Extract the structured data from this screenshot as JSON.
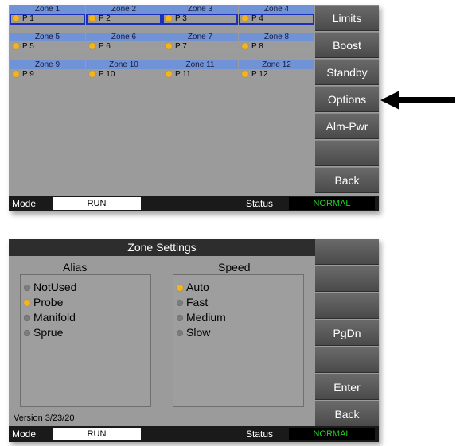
{
  "screen1": {
    "zones": [
      {
        "name": "Zone 1",
        "label": "P 1",
        "selected": true
      },
      {
        "name": "Zone 2",
        "label": "P 2",
        "selected": true
      },
      {
        "name": "Zone 3",
        "label": "P 3",
        "selected": true
      },
      {
        "name": "Zone 4",
        "label": "P 4",
        "selected": true
      },
      {
        "name": "Zone 5",
        "label": "P 5",
        "selected": false
      },
      {
        "name": "Zone 6",
        "label": "P 6",
        "selected": false
      },
      {
        "name": "Zone 7",
        "label": "P 7",
        "selected": false
      },
      {
        "name": "Zone 8",
        "label": "P 8",
        "selected": false
      },
      {
        "name": "Zone 9",
        "label": "P 9",
        "selected": false
      },
      {
        "name": "Zone 10",
        "label": "P 10",
        "selected": false
      },
      {
        "name": "Zone 11",
        "label": "P 11",
        "selected": false
      },
      {
        "name": "Zone 12",
        "label": "P 12",
        "selected": false
      }
    ],
    "buttons": [
      "Limits",
      "Boost",
      "Standby",
      "Options",
      "Alm-Pwr",
      "",
      "Back"
    ],
    "status": {
      "mode_label": "Mode",
      "mode_value": "RUN",
      "status_label": "Status",
      "status_value": "NORMAL"
    }
  },
  "screen2": {
    "title": "Zone Settings",
    "alias_header": "Alias",
    "speed_header": "Speed",
    "alias_options": [
      {
        "label": "NotUsed",
        "on": false
      },
      {
        "label": "Probe",
        "on": true
      },
      {
        "label": "Manifold",
        "on": false
      },
      {
        "label": "Sprue",
        "on": false
      }
    ],
    "speed_options": [
      {
        "label": "Auto",
        "on": true
      },
      {
        "label": "Fast",
        "on": false
      },
      {
        "label": "Medium",
        "on": false
      },
      {
        "label": "Slow",
        "on": false
      }
    ],
    "buttons": [
      "",
      "",
      "",
      "PgDn",
      "",
      "Enter",
      "Back"
    ],
    "version": "Version 3/23/20",
    "status": {
      "mode_label": "Mode",
      "mode_value": "RUN",
      "status_label": "Status",
      "status_value": "NORMAL"
    }
  },
  "colors": {
    "zone_header": "#6f93d6",
    "selected_outline": "#1c2fb8",
    "indicator_on": "#f4b41a",
    "status_ok": "#20d020"
  }
}
